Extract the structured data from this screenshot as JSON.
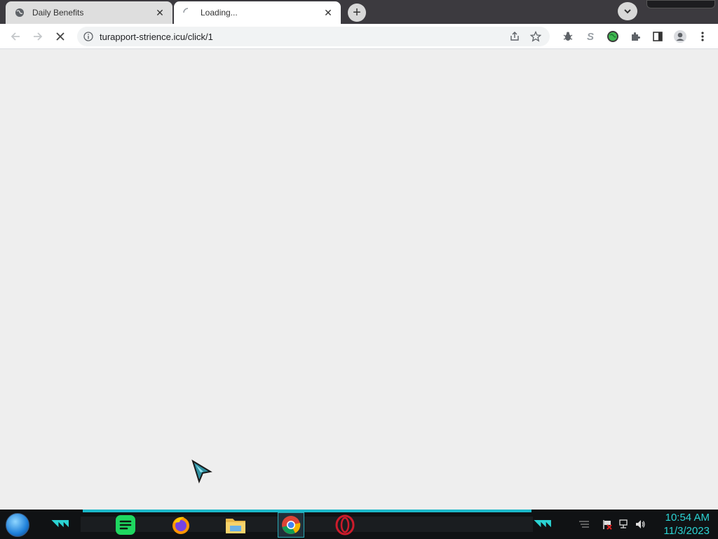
{
  "browser": {
    "tabs": [
      {
        "title": "Daily Benefits",
        "active": false,
        "icon": "globe-icon"
      },
      {
        "title": "Loading...",
        "active": true,
        "icon": "loading-spinner-icon"
      }
    ],
    "new_tab_icon": "+",
    "address": {
      "url": "turapport-strience.icu/click/1"
    },
    "toolbar_icons": [
      "back-icon",
      "forward-icon",
      "stop-icon",
      "share-icon",
      "bookmark-star-icon",
      "extension-bug-icon",
      "extension-s-icon",
      "extension-globe-icon",
      "extensions-puzzle-icon",
      "side-panel-icon",
      "profile-icon",
      "menu-icon"
    ],
    "extension_s_label": "S"
  },
  "taskbar": {
    "apps": [
      "spotify-icon",
      "firefox-icon",
      "file-explorer-icon",
      "chrome-icon",
      "opera-icon"
    ],
    "clock": {
      "time": "10:54 AM",
      "date": "11/3/2023"
    },
    "accent_color": "#2bd3d3"
  }
}
